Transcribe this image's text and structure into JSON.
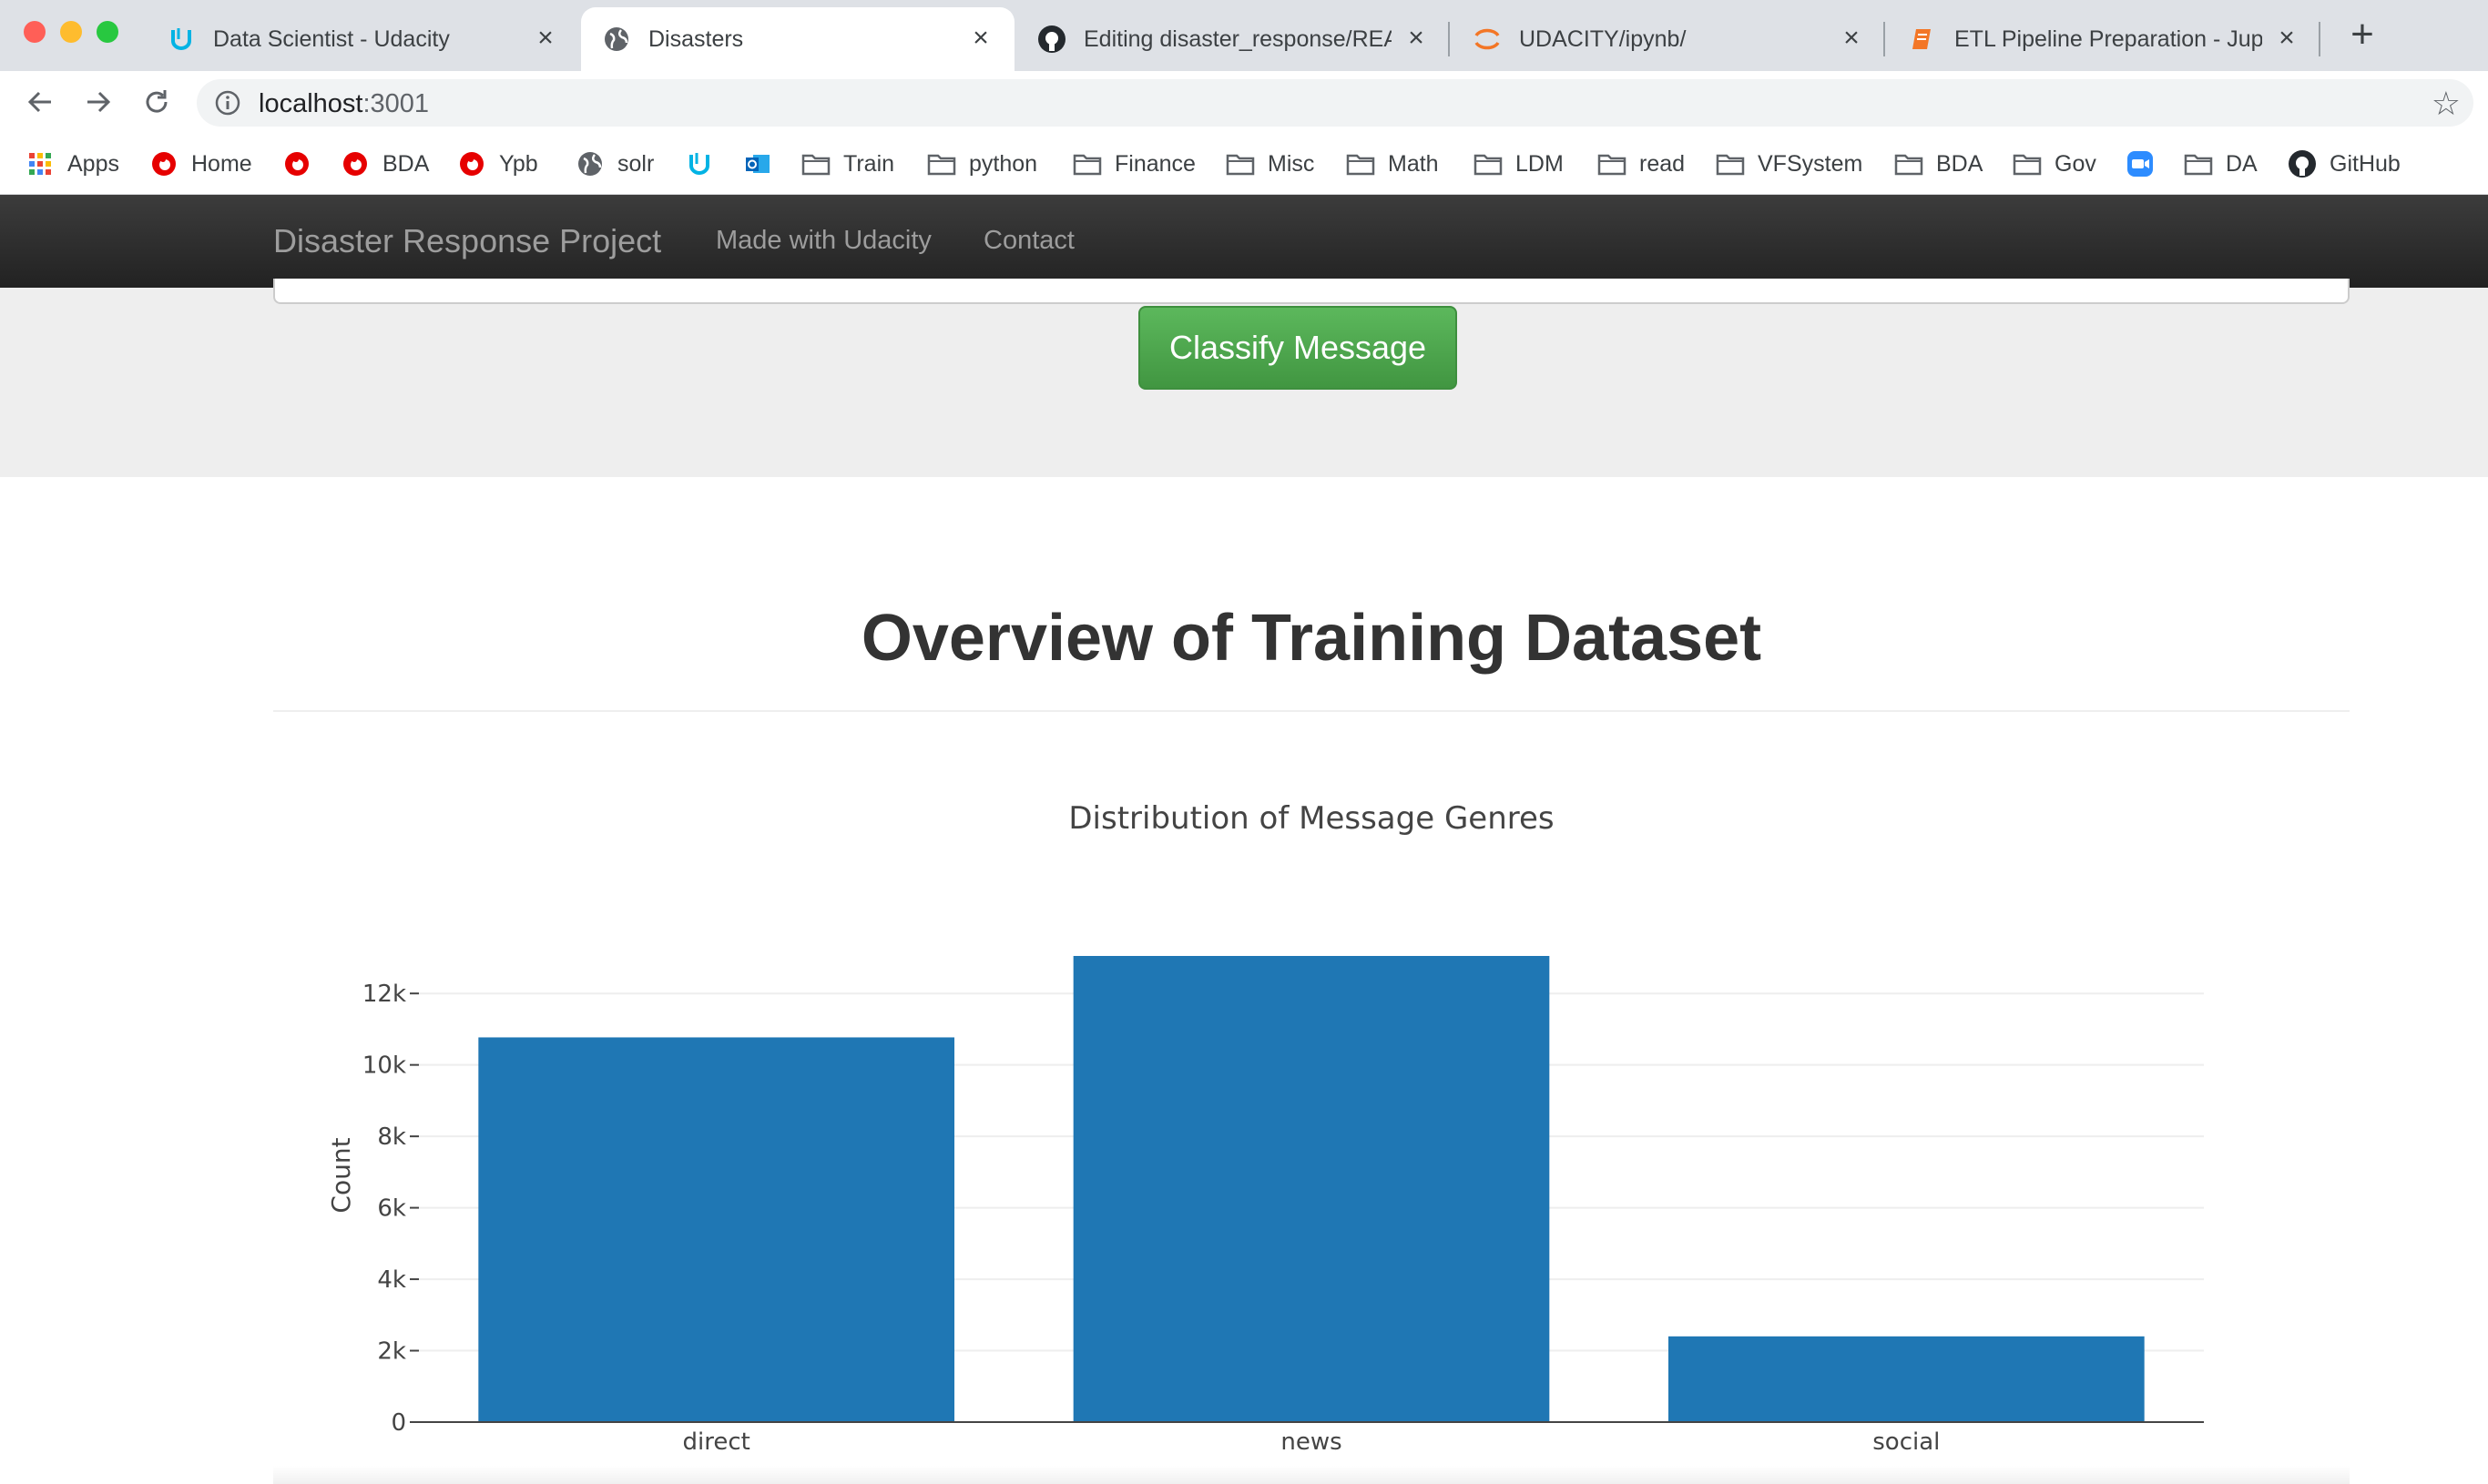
{
  "browser": {
    "tabs": [
      {
        "title": "Data Scientist - Udacity",
        "icon": "udacity-icon",
        "active": false
      },
      {
        "title": "Disasters",
        "icon": "globe-icon",
        "active": true
      },
      {
        "title": "Editing disaster_response/REA",
        "icon": "github-icon",
        "active": false
      },
      {
        "title": "UDACITY/ipynb/",
        "icon": "jupyter-icon",
        "active": false
      },
      {
        "title": "ETL Pipeline Preparation - Jupy",
        "icon": "notebook-icon",
        "active": false
      }
    ],
    "address": {
      "host": "localhost",
      "port": ":3001"
    },
    "bookmarks": [
      {
        "label": "Apps",
        "icon": "apps-grid-icon"
      },
      {
        "label": "Home",
        "icon": "vodafone-icon"
      },
      {
        "label": "",
        "icon": "vodafone-icon"
      },
      {
        "label": "BDA",
        "icon": "vodafone-icon"
      },
      {
        "label": "Ypb",
        "icon": "vodafone-icon"
      },
      {
        "label": "solr",
        "icon": "globe-icon"
      },
      {
        "label": "",
        "icon": "udacity-icon"
      },
      {
        "label": "",
        "icon": "outlook-icon"
      },
      {
        "label": "Train",
        "icon": "folder-icon"
      },
      {
        "label": "python",
        "icon": "folder-icon"
      },
      {
        "label": "Finance",
        "icon": "folder-icon"
      },
      {
        "label": "Misc",
        "icon": "folder-icon"
      },
      {
        "label": "Math",
        "icon": "folder-icon"
      },
      {
        "label": "LDM",
        "icon": "folder-icon"
      },
      {
        "label": "read",
        "icon": "folder-icon"
      },
      {
        "label": "VFSystem",
        "icon": "folder-icon"
      },
      {
        "label": "BDA",
        "icon": "folder-icon"
      },
      {
        "label": "Gov",
        "icon": "folder-icon"
      },
      {
        "label": "",
        "icon": "zoom-icon"
      },
      {
        "label": "DA",
        "icon": "folder-icon"
      },
      {
        "label": "GitHub",
        "icon": "github-icon"
      }
    ]
  },
  "navbar": {
    "brand": "Disaster Response Project",
    "links": [
      "Made with Udacity",
      "Contact"
    ]
  },
  "jumbotron": {
    "classify_label": "Classify Message"
  },
  "content": {
    "heading": "Overview of Training Dataset"
  },
  "colors": {
    "bar": "#1f77b4",
    "button_green": "#5cb85c",
    "navbar_dark": "#222222"
  },
  "chart_data": {
    "type": "bar",
    "title": "Distribution of Message Genres",
    "xlabel": "",
    "ylabel": "Count",
    "categories": [
      "direct",
      "news",
      "social"
    ],
    "values": [
      10770,
      13050,
      2400
    ],
    "ylim": [
      0,
      13050
    ],
    "yticks": [
      0,
      2000,
      4000,
      6000,
      8000,
      10000,
      12000
    ],
    "ytick_labels": [
      "0",
      "2k",
      "4k",
      "6k",
      "8k",
      "10k",
      "12k"
    ],
    "grid": true,
    "legend": false
  }
}
